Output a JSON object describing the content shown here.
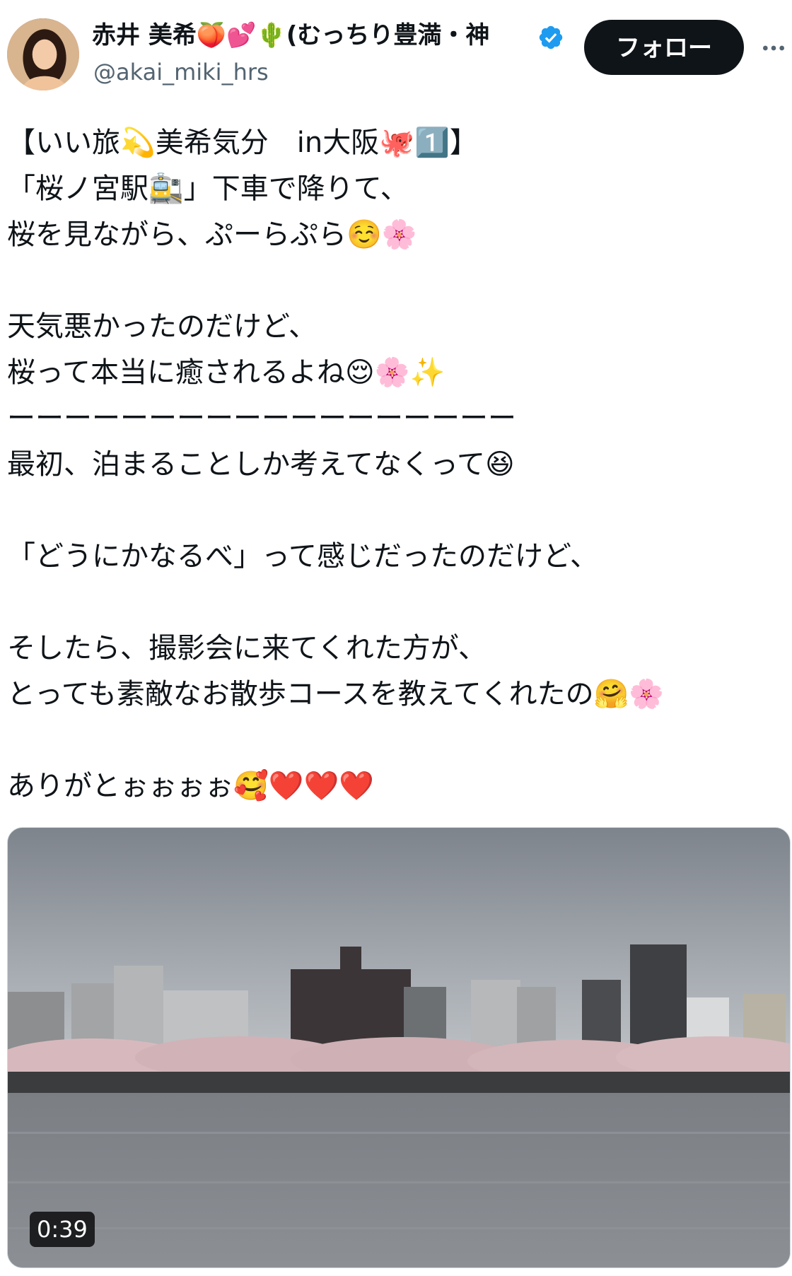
{
  "author": {
    "display_name": "赤井 美希🍑💕🌵(むっちり豊満・神",
    "handle": "@akai_miki_hrs",
    "verified_icon": "verified-badge-icon",
    "verified_color": "#1d9bf0"
  },
  "actions": {
    "follow_label": "フォロー",
    "more_icon": "more-dots-icon"
  },
  "tweet": {
    "lines": [
      "【いい旅💫美希気分　in大阪🐙1️⃣】",
      "「桜ノ宮駅🚉」下車で降りて、",
      "桜を見ながら、ぷーらぷら☺️🌸",
      "",
      "天気悪かったのだけど、",
      "桜って本当に癒されるよね😌🌸✨",
      "ーーーーーーーーーーーーーーーーーー",
      "最初、泊まることしか考えてなくって😆",
      "",
      "「どうにかなるべ」って感じだったのだけど、",
      "",
      "そしたら、撮影会に来てくれた方が、",
      "とっても素敵なお散歩コースを教えてくれたの🤗🌸",
      "",
      "ありがとぉぉぉぉ🥰❤️❤️❤️"
    ]
  },
  "media": {
    "type": "video",
    "duration": "0:39",
    "description_icon": "video-thumbnail"
  }
}
